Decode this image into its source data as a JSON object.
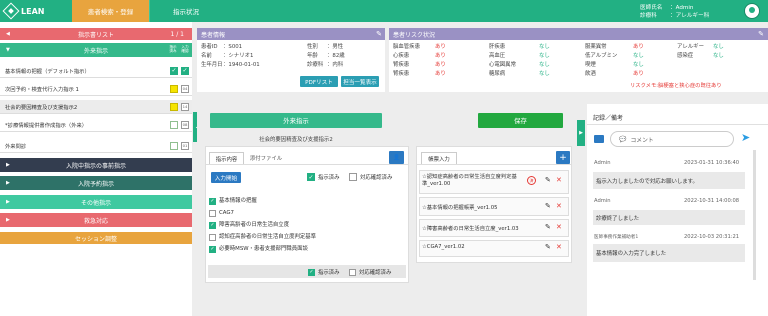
{
  "app": {
    "logo": "LEAN",
    "tabs": [
      "患者検索・登録",
      "指示状況"
    ]
  },
  "user": {
    "hospital_label": "医師氏名",
    "hospital_value": "Admin",
    "dept_label": "診療科",
    "dept_value": "アレルギー科"
  },
  "left": {
    "list_title": "指示書リスト",
    "list_count": "1 / 1",
    "outpatient": "外来指示",
    "col_a": "指示済み",
    "col_b": "入力確認",
    "items": [
      {
        "label": "基本情報の把握（デフォルト指示）",
        "a": "checked",
        "b": "checked"
      },
      {
        "label": "次回予約・検査代行入力指示 1",
        "a": "yellow",
        "b": "04"
      },
      {
        "label": "社会的要因精査及び支援指示2",
        "a": "yellow",
        "b": "14"
      },
      {
        "label": "*診療情報提供書作成指示（外来）",
        "a": "empty",
        "b": "08"
      },
      {
        "label": "外来問診",
        "a": "empty",
        "b": "01"
      }
    ],
    "sections": [
      "入院中指示の事前指示",
      "入院予約指示",
      "その他指示",
      "救急対応",
      "セッション調整"
    ]
  },
  "patient": {
    "title": "患者情報",
    "rows": [
      [
        "患者ID",
        "S001",
        "性別",
        "男性"
      ],
      [
        "名前",
        "シナリオ1",
        "年齢",
        "82歳"
      ],
      [
        "生年月日",
        "1940-01-01",
        "診療科",
        "内科"
      ]
    ],
    "pdf_btn": "PDFリスト",
    "history_btn": "担当一覧表示"
  },
  "risk": {
    "title": "患者リスク状況",
    "cols": [
      [
        [
          "脳血管疾患",
          "あり"
        ],
        [
          "心疾患",
          "あり"
        ],
        [
          "腎疾患",
          "あり"
        ],
        [
          "腎疾患",
          "あり"
        ]
      ],
      [
        [
          "肝疾患",
          "なし"
        ],
        [
          "高血圧",
          "なし"
        ],
        [
          "心電図異常",
          "なし"
        ],
        [
          "糖尿病",
          "なし"
        ]
      ],
      [
        [
          "服薬異常",
          "あり"
        ],
        [
          "低アルブミン",
          "なし"
        ],
        [
          "喫煙",
          "なし"
        ],
        [
          "飲酒",
          "あり"
        ]
      ],
      [
        [
          "アレルギー",
          "なし"
        ],
        [
          "感染症",
          "なし"
        ]
      ]
    ],
    "note_label": "リスクメモ:",
    "note": "脳梗塞と狭心症の既往あり"
  },
  "center": {
    "outpatient_btn": "外来指示",
    "save_btn": "保存",
    "subtitle": "社会的要因精査及び支援指示2",
    "tabs": [
      "指示内容",
      "添付ファイル"
    ],
    "input_btn": "入力開始",
    "done_label": "指示済み",
    "confirm_label": "対応確認済み",
    "checks": [
      {
        "label": "基本情報の把握",
        "on": true
      },
      {
        "label": "CAG7",
        "on": false
      },
      {
        "label": "障害高齢者の日常生活自立度",
        "on": true
      },
      {
        "label": "認知症高齢者の日常生活自立度判定基準",
        "on": false
      },
      {
        "label": "必要時MSW・患者支援部門職員面談",
        "on": true
      }
    ],
    "foot_done": "指示済み",
    "foot_confirm": "対応確認済み"
  },
  "forms": {
    "title": "帳票入力",
    "items": [
      "☆認知症高齢者の日常生活自立度判定基準_ver1.00",
      "☆基本情報の把握帳票_ver1.05",
      "☆障害高齢者の日常生活自立度_ver1.03",
      "☆CGA7_ver1.02"
    ]
  },
  "memo": {
    "title": "記録／備考",
    "placeholder": "コメント",
    "entries": [
      {
        "author": "Admin",
        "time": "2023-01-31 10:36:40",
        "text": "指示入力しましたので対応お願いします。"
      },
      {
        "author": "Admin",
        "time": "2022-10-31 14:00:08",
        "text": "診療終了しました"
      },
      {
        "author": "医師事務作業補助者1",
        "time": "2022-10-03 20:31:21",
        "text": "基本情報の入力完了しました"
      }
    ]
  }
}
